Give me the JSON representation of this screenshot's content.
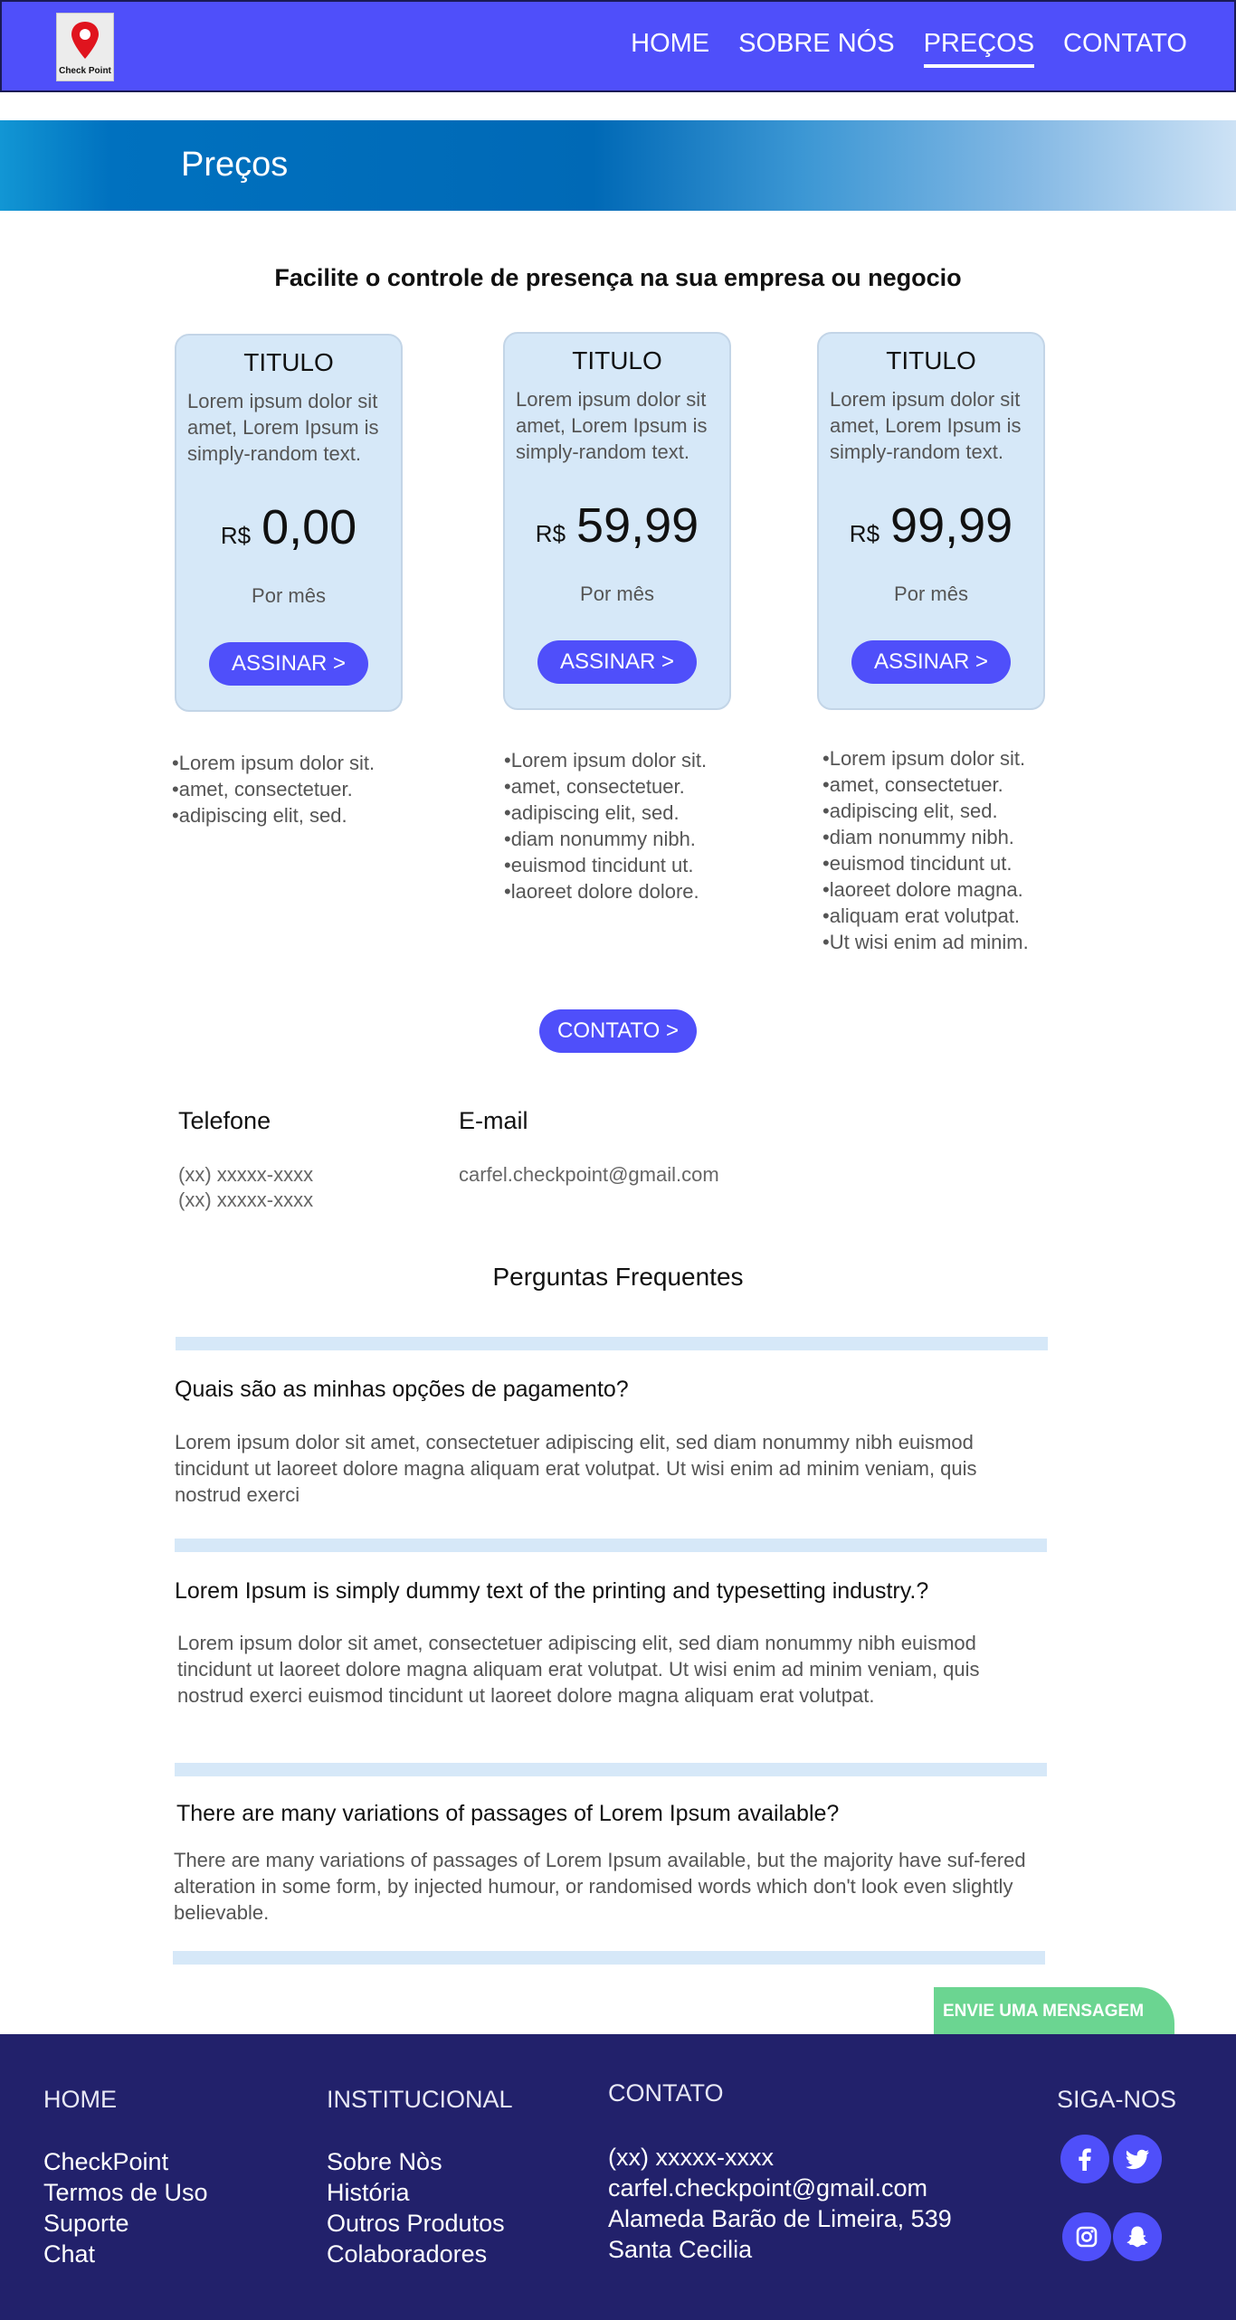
{
  "header": {
    "logo_text": "Check Point",
    "nav": [
      {
        "label": "HOME",
        "active": false
      },
      {
        "label": "SOBRE NÓS",
        "active": false
      },
      {
        "label": "PREÇOS",
        "active": true
      },
      {
        "label": "CONTATO",
        "active": false
      }
    ]
  },
  "banner": {
    "title": "Preços"
  },
  "tagline": "Facilite o controle de presença na sua empresa ou negocio",
  "plans": [
    {
      "title": "TITULO",
      "description": "Lorem ipsum dolor sit amet, Lorem Ipsum is simply-random text.",
      "currency": "R$",
      "price": "0,00",
      "period": "Por mês",
      "cta": "ASSINAR >",
      "features": [
        "•Lorem ipsum dolor sit.",
        "•amet, consectetuer.",
        "•adipiscing elit, sed."
      ]
    },
    {
      "title": "TITULO",
      "description": "Lorem ipsum dolor sit amet, Lorem Ipsum is simply-random text.",
      "currency": "R$",
      "price": "59,99",
      "period": "Por mês",
      "cta": "ASSINAR >",
      "features": [
        "•Lorem ipsum dolor sit.",
        "•amet, consectetuer.",
        "•adipiscing elit, sed.",
        "•diam nonummy nibh.",
        "•euismod tincidunt ut.",
        "•laoreet dolore dolore."
      ]
    },
    {
      "title": "TITULO",
      "description": "Lorem ipsum dolor sit amet, Lorem Ipsum is simply-random text.",
      "currency": "R$",
      "price": "99,99",
      "period": "Por mês",
      "cta": "ASSINAR >",
      "features": [
        "•Lorem ipsum dolor sit.",
        "•amet, consectetuer.",
        "•adipiscing elit, sed.",
        "•diam nonummy nibh.",
        "•euismod tincidunt ut.",
        "•laoreet dolore magna.",
        "•aliquam erat volutpat.",
        "•Ut wisi enim ad minim."
      ]
    }
  ],
  "contact_button": "CONTATO >",
  "contact_info": {
    "phone_label": "Telefone",
    "phones": [
      "(xx) xxxxx-xxxx",
      "(xx) xxxxx-xxxx"
    ],
    "email_label": "E-mail",
    "email": "carfel.checkpoint@gmail.com"
  },
  "faq": {
    "title": "Perguntas Frequentes",
    "items": [
      {
        "question": "Quais são as minhas opções de pagamento?",
        "answer": "Lorem ipsum dolor sit amet, consectetuer adipiscing elit, sed diam nonummy nibh euismod tincidunt ut laoreet dolore magna aliquam erat volutpat. Ut wisi enim ad minim veniam, quis nostrud exerci"
      },
      {
        "question": "Lorem Ipsum is simply dummy text of the printing and typesetting industry.?",
        "answer": "Lorem ipsum dolor sit amet, consectetuer adipiscing elit, sed diam nonummy nibh euismod tincidunt ut laoreet dolore magna aliquam erat volutpat. Ut wisi enim ad minim veniam, quis nostrud exerci euismod tincidunt ut laoreet dolore magna aliquam erat volutpat."
      },
      {
        "question": "There are many variations of passages of Lorem Ipsum available?",
        "answer": "There are many variations of passages of Lorem Ipsum available, but the majority have suf-fered alteration in some form, by injected humour, or randomised words which don't look even slightly believable."
      }
    ]
  },
  "send_message": "ENVIE UMA MENSAGEM",
  "footer": {
    "home": {
      "title": "HOME",
      "links": [
        "CheckPoint",
        "Termos de Uso",
        "Suporte",
        "Chat"
      ]
    },
    "institucional": {
      "title": "INSTITUCIONAL",
      "links": [
        "Sobre Nòs",
        "História",
        "Outros Produtos",
        "Colaboradores"
      ]
    },
    "contato": {
      "title": "CONTATO",
      "lines": [
        "(xx) xxxxx-xxxx",
        "carfel.checkpoint@gmail.com",
        "Alameda Barão de Limeira, 539",
        "Santa Cecilia"
      ]
    },
    "social": {
      "title": "SIGA-NOS",
      "icons": [
        "facebook-icon",
        "twitter-icon",
        "instagram-icon",
        "snapchat-icon"
      ]
    }
  },
  "colors": {
    "primary": "#4f4ffa",
    "card_bg": "#d6e8f8",
    "footer_bg": "#22216b",
    "send_message_bg": "#6bd591",
    "banner_dark": "#0069b6"
  }
}
